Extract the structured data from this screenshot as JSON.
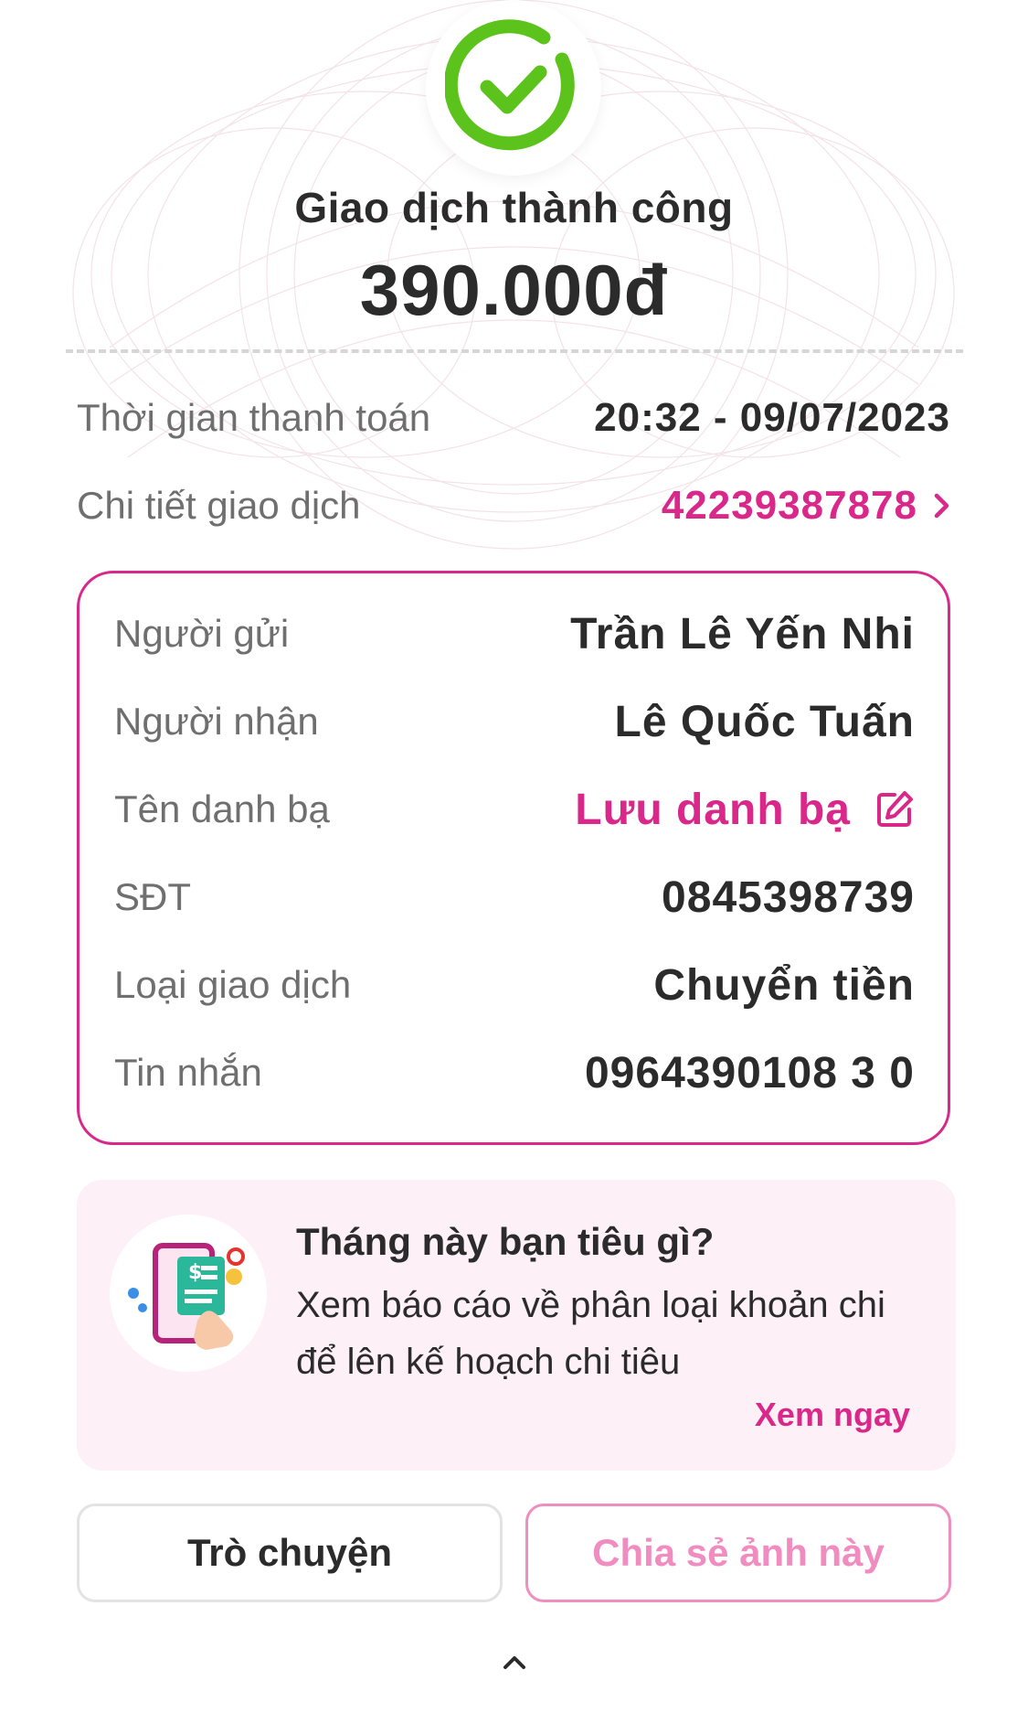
{
  "status": {
    "icon": "check-circle-icon",
    "title": "Giao dịch thành công",
    "amount": "390.000đ"
  },
  "summary": {
    "time_label": "Thời gian thanh toán",
    "time_value": "20:32 - 09/07/2023",
    "detail_label": "Chi tiết giao dịch",
    "detail_value": "42239387878"
  },
  "details": {
    "sender_label": "Người gửi",
    "sender_value": "Trần Lê Yến Nhi",
    "receiver_label": "Người nhận",
    "receiver_value": "Lê Quốc Tuấn",
    "contact_label": "Tên danh bạ",
    "contact_value": "Lưu danh bạ",
    "phone_label": "SĐT",
    "phone_value": "0845398739",
    "type_label": "Loại giao dịch",
    "type_value": "Chuyển tiền",
    "message_label": "Tin nhắn",
    "message_value": "0964390108 3 0"
  },
  "promo": {
    "title": "Tháng này bạn tiêu gì?",
    "description": "Xem báo cáo về phân loại khoản chi để lên kế hoạch chi tiêu",
    "link": "Xem ngay"
  },
  "actions": {
    "chat_label": "Trò chuyện",
    "share_label": "Chia sẻ ảnh này"
  },
  "colors": {
    "accent": "#d9278a",
    "success": "#5cc31c",
    "text": "#2b2b2b",
    "muted": "#6f6f6f"
  }
}
